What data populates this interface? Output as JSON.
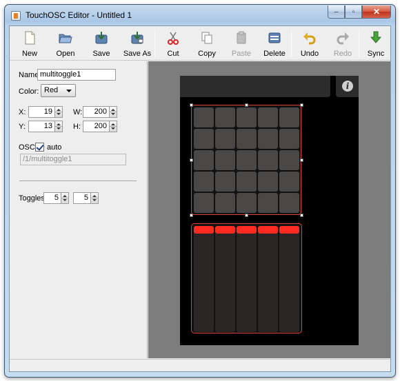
{
  "window": {
    "title": "TouchOSC Editor - Untitled 1",
    "min": "–",
    "max": "▫",
    "close": "✕"
  },
  "toolbar": {
    "new": "New",
    "open": "Open",
    "save": "Save",
    "save_as": "Save As",
    "cut": "Cut",
    "copy": "Copy",
    "paste": "Paste",
    "delete": "Delete",
    "undo": "Undo",
    "redo": "Redo",
    "sync": "Sync"
  },
  "properties": {
    "name_label": "Name:",
    "name_value": "multitoggle1",
    "color_label": "Color:",
    "color_value": "Red",
    "x_label": "X:",
    "x_value": "19",
    "y_label": "Y:",
    "y_value": "13",
    "w_label": "W:",
    "w_value": "200",
    "h_label": "H:",
    "h_value": "200",
    "osc_label": "OSC:",
    "osc_auto_label": "auto",
    "osc_auto_checked": true,
    "osc_address": "/1/multitoggle1",
    "toggles_label": "Toggles:",
    "toggles_x": "5",
    "toggles_y": "5"
  },
  "canvas": {
    "info_symbol": "i",
    "grid": {
      "columns": 5,
      "rows": 5
    },
    "faders": {
      "count": 5
    },
    "colors": {
      "accent": "#ff2a20",
      "cell": "#4a4747",
      "background": "#000000"
    }
  }
}
